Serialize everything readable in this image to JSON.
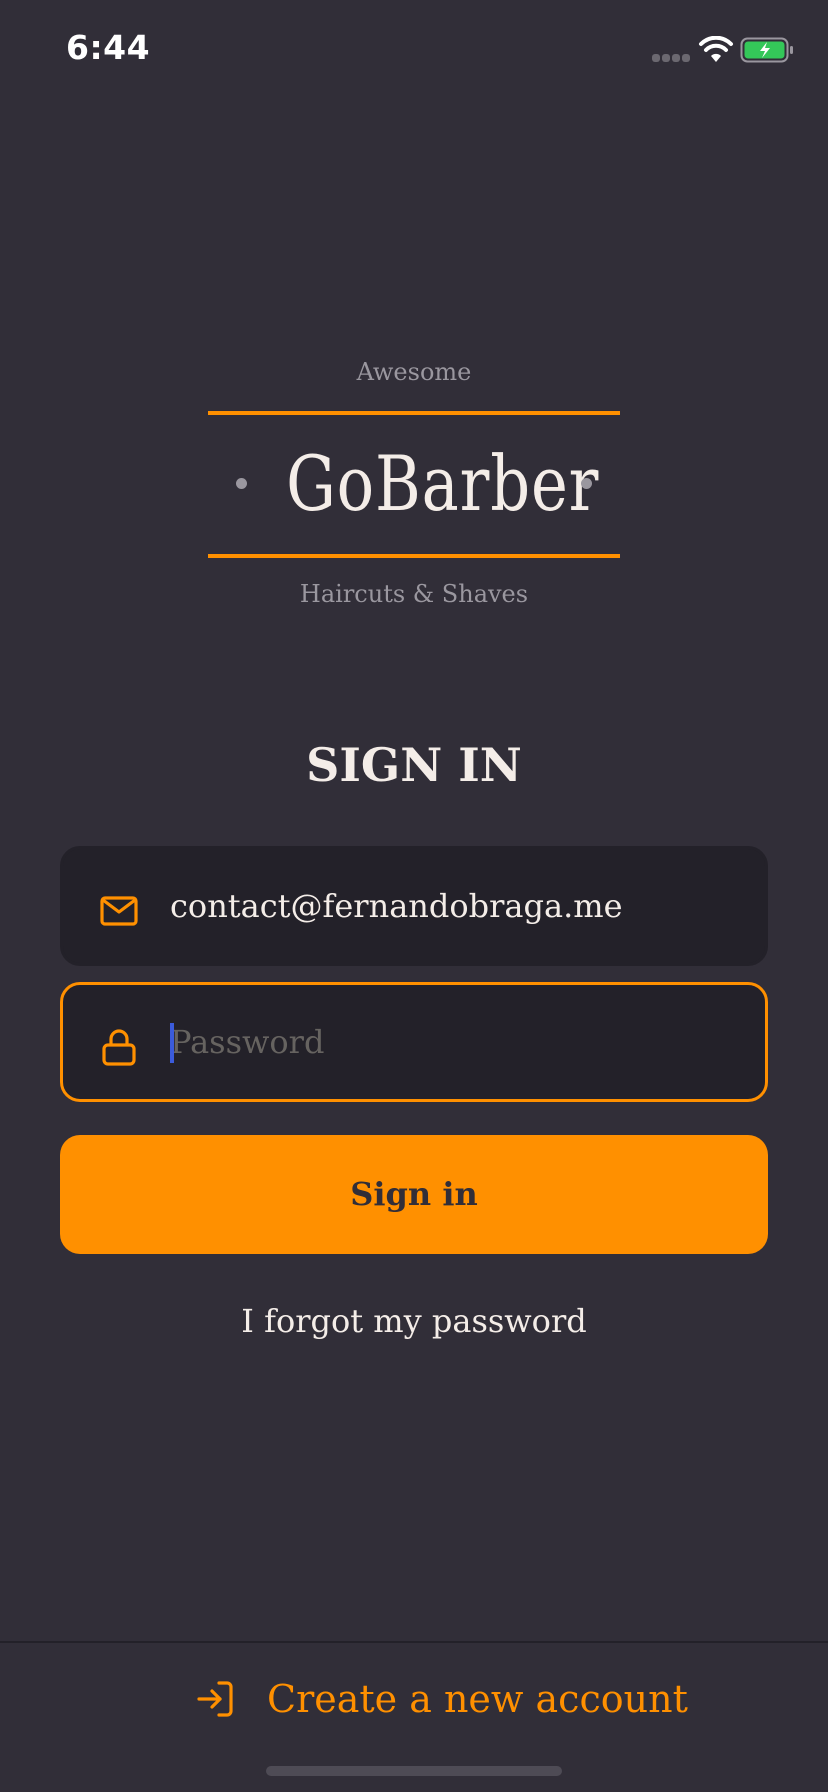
{
  "status_bar": {
    "time": "6:44"
  },
  "logo": {
    "tagline_top": "Awesome",
    "name": "GoBarber",
    "tagline_bottom": "Haircuts & Shaves"
  },
  "form": {
    "title": "SIGN IN",
    "email": {
      "value": "contact@fernandobraga.me",
      "icon": "mail-icon"
    },
    "password": {
      "placeholder": "Password",
      "value": "",
      "icon": "lock-icon",
      "focused": true
    },
    "submit_label": "Sign in",
    "forgot_label": "I forgot my password"
  },
  "footer": {
    "create_account_label": "Create a new account",
    "icon": "log-in-icon"
  },
  "colors": {
    "background": "#312e38",
    "input_background": "#232129",
    "accent": "#ff9000",
    "text": "#f4ede8",
    "muted": "#666360"
  }
}
